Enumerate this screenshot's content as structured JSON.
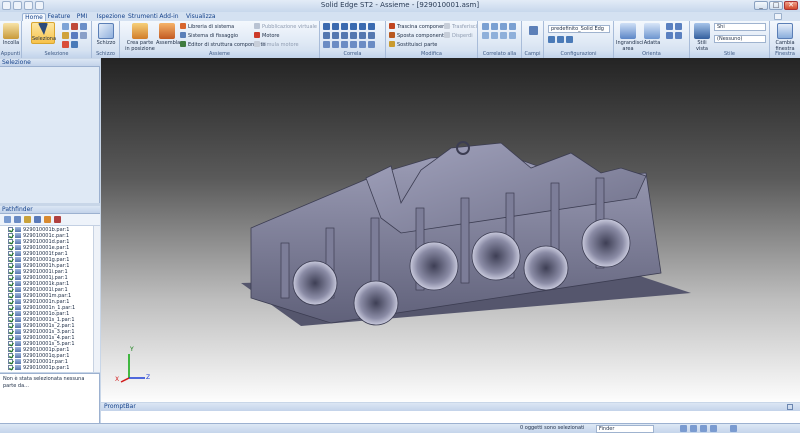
{
  "window": {
    "title": "Solid Edge ST2 - Assieme - [929010001.asm]"
  },
  "tabs": [
    "Home",
    "Feature",
    "PMI",
    "Ispezione",
    "Strumenti",
    "Add-in",
    "Visualizza"
  ],
  "ribbon": {
    "groups": {
      "appunti": "Appunti",
      "selezione": "Selezione",
      "schizzo": "Schizzo",
      "assieme": "Assieme",
      "correla": "Correla",
      "modifica": "Modifica",
      "correlato_alla_faccia": "Correlato alla faccia",
      "campi": "Campi",
      "configurazioni": "Configurazioni",
      "orienta": "Orienta",
      "stile": "Stile",
      "finestra": "Finestra"
    },
    "buttons": {
      "incolla": "Incolla",
      "seleziona": "Seleziona",
      "schizzo": "Schizzo",
      "crea_parte": "Crea parte in posizione",
      "assembla": "Assembla",
      "libreria_sistema": "Libreria di sistema",
      "sistema_fissaggio": "Sistema di fissaggio",
      "editor_struttura": "Editor di struttura componente",
      "pubblicazione_virtuale": "Pubblicazione virtuale",
      "motore": "Motore",
      "simula_motore": "Simula motore",
      "trascina_componente": "Trascina componente",
      "sposta_componenti": "Sposta componenti",
      "sostituisci_parte": "Sostituisci parte",
      "trasferisci": "Trasferisci",
      "disperdi": "Disperdi",
      "config_value": "predefinito_Solid Edg",
      "ingrandisci_area": "Ingrandisci area",
      "adatta": "Adatta",
      "stili_vista": "Stili vista",
      "stile_value": "Shi",
      "nessuno_value": "(Nessuno)",
      "cambia_finestra": "Cambia finestra"
    }
  },
  "panels": {
    "selezione": "Selezione",
    "pathfinder": "Pathfinder",
    "pathfinder_items": [
      "929010001b.par:1",
      "929010001c.par:1",
      "929010001d.par:1",
      "929010001e.par:1",
      "929010001f.par:1",
      "929010001g.par:1",
      "929010001h.par:1",
      "929010001i.par:1",
      "929010001j.par:1",
      "929010001k.par:1",
      "929010001l.par:1",
      "929010001m.par:1",
      "929010001n.par:1",
      "929010001n_1.par:1",
      "929010001o.par:1",
      "929010001s_1.par:1",
      "929010001s_2.par:1",
      "929010001s_3.par:1",
      "929010001s_4.par:1",
      "929010001s_5.par:1",
      "929010001p.par:1",
      "929010001q.par:1",
      "929010001r.par:1",
      "929010001p.par:1"
    ],
    "message": "Non è stata selezionata nessuna parte da..."
  },
  "viewport": {
    "triad": {
      "x": "X",
      "y": "Y",
      "z": "Z"
    }
  },
  "promptbar": {
    "title": "PromptBar"
  },
  "status": {
    "selection": "0 oggetti sono selezionati",
    "finder_label": "Finder"
  },
  "colors": {
    "ribbon_bg": "#dfe9f5",
    "accent": "#15428b",
    "model": "#8e8fa8"
  }
}
